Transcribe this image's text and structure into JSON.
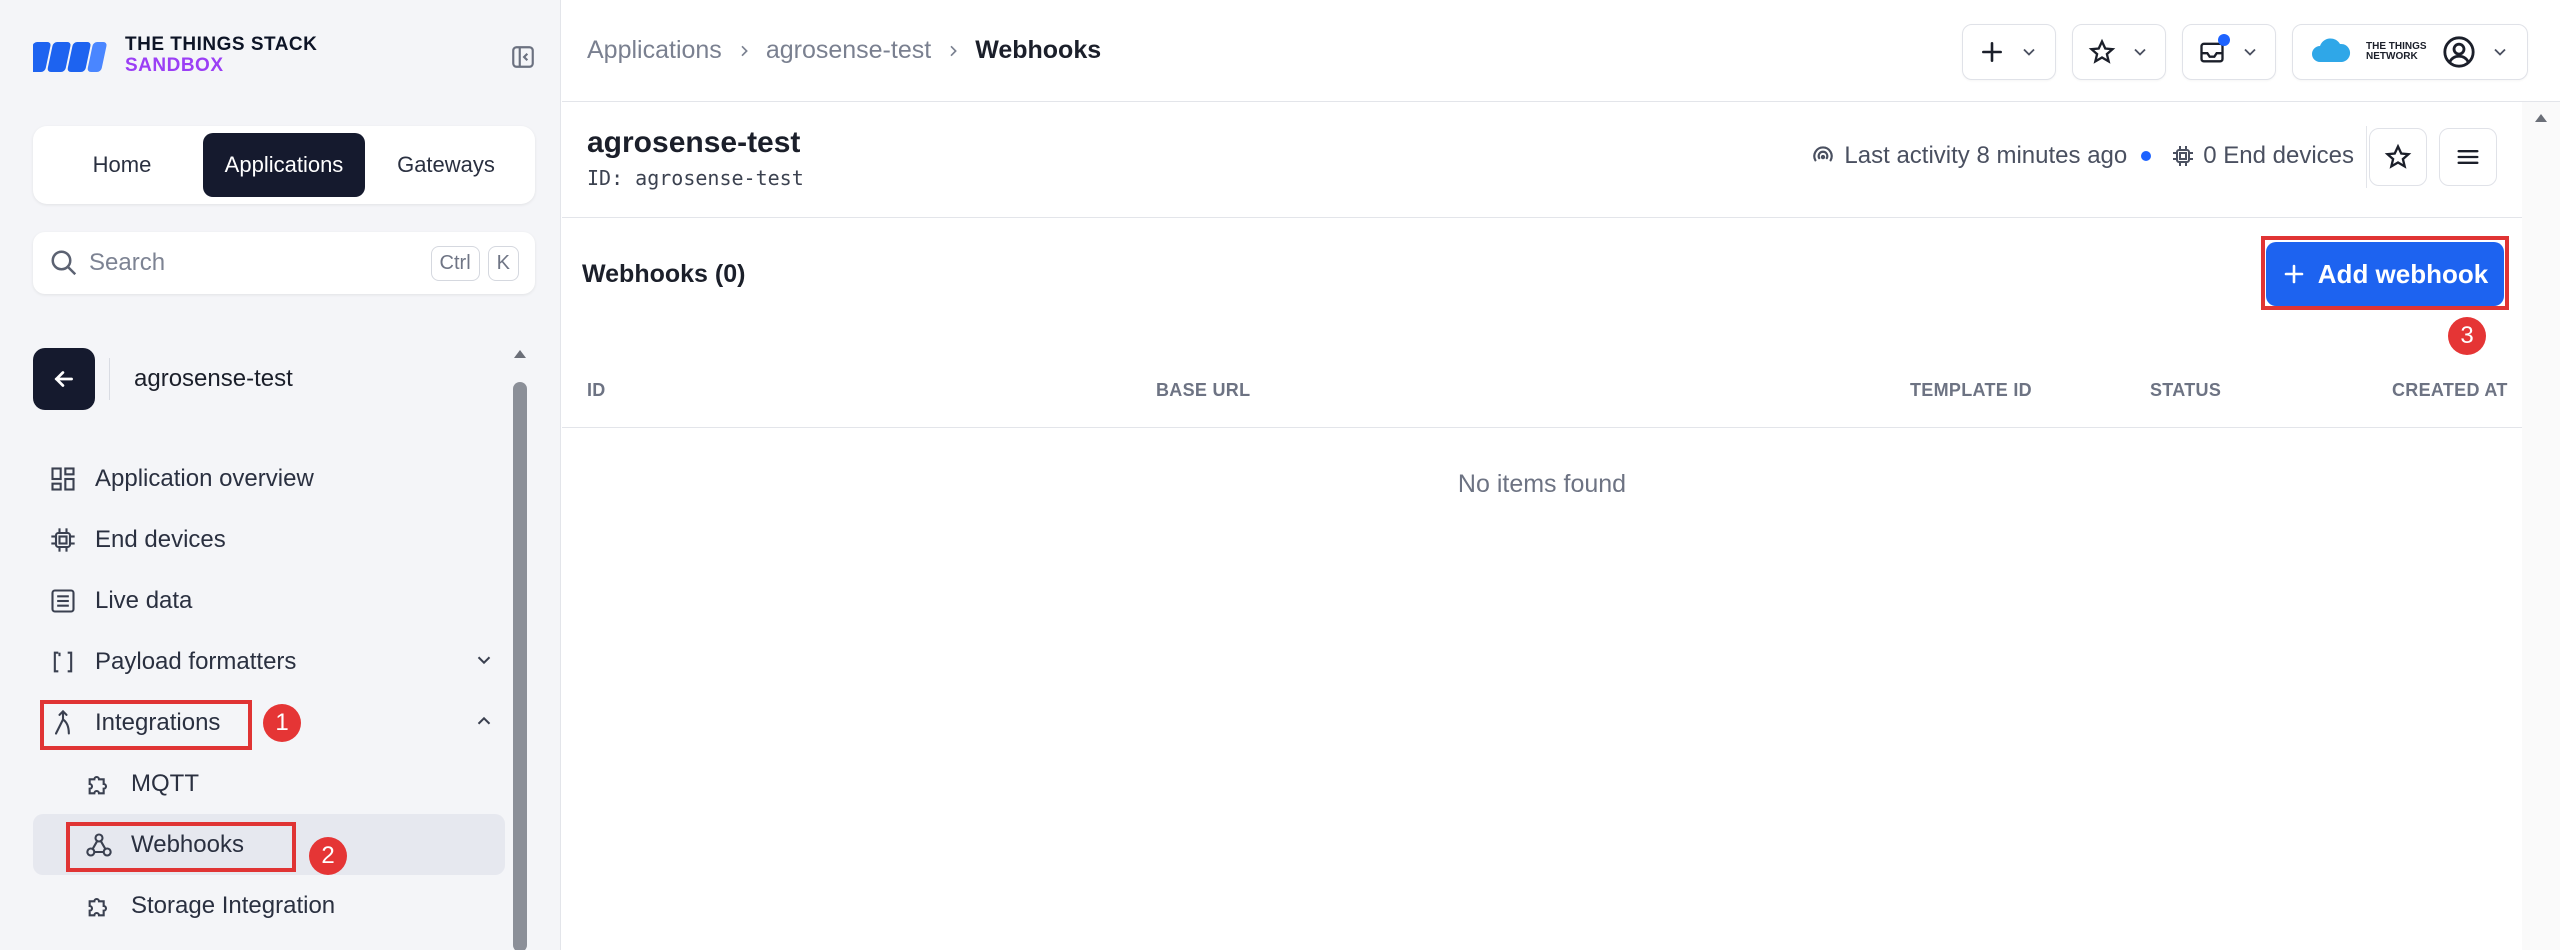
{
  "logo": {
    "line1": "THE THINGS STACK",
    "line2": "SANDBOX"
  },
  "nav": {
    "tabs": [
      {
        "label": "Home"
      },
      {
        "label": "Applications"
      },
      {
        "label": "Gateways"
      }
    ],
    "active": "Applications"
  },
  "search": {
    "placeholder": "Search",
    "shortcut1": "Ctrl",
    "shortcut2": "K"
  },
  "app_context": {
    "name": "agrosense-test"
  },
  "sidebar": {
    "items": [
      {
        "label": "Application overview"
      },
      {
        "label": "End devices"
      },
      {
        "label": "Live data"
      },
      {
        "label": "Payload formatters"
      },
      {
        "label": "Integrations"
      },
      {
        "label": "MQTT"
      },
      {
        "label": "Webhooks"
      },
      {
        "label": "Storage Integration"
      }
    ]
  },
  "annotations": {
    "badge1": "1",
    "badge2": "2",
    "badge3": "3",
    "color": "#e53535"
  },
  "breadcrumb": {
    "items": [
      "Applications",
      "agrosense-test",
      "Webhooks"
    ]
  },
  "topbar": {
    "network_logo_text": "THE THINGS NETWORK"
  },
  "header": {
    "title": "agrosense-test",
    "id_label": "ID:",
    "id_value": "agrosense-test",
    "last_activity": "Last activity 8 minutes ago",
    "end_devices": "0 End devices"
  },
  "webhooks": {
    "title": "Webhooks (0)",
    "add_button": "Add webhook",
    "columns": [
      "ID",
      "BASE URL",
      "TEMPLATE ID",
      "STATUS",
      "CREATED AT"
    ],
    "empty_text": "No items found"
  },
  "colors": {
    "primary": "#1d63f0",
    "dark": "#151a2e",
    "sandbox": "#9b3ff5"
  }
}
